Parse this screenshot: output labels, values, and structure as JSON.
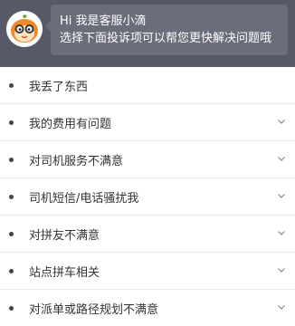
{
  "header": {
    "bubble_line1": "Hi 我是客服小滴",
    "bubble_line2": "选择下面投诉项可以帮您更快解决问题哦"
  },
  "colors": {
    "header_bg": "#575968",
    "bubble_bg": "#6b6d7a",
    "avatar_orange": "#f08a24"
  },
  "list": {
    "items": [
      {
        "label": "我丢了东西",
        "has_chevron": false
      },
      {
        "label": "我的费用有问题",
        "has_chevron": true
      },
      {
        "label": "对司机服务不满意",
        "has_chevron": true
      },
      {
        "label": "司机短信/电话骚扰我",
        "has_chevron": true
      },
      {
        "label": "对拼友不满意",
        "has_chevron": true
      },
      {
        "label": "站点拼车相关",
        "has_chevron": true
      },
      {
        "label": "对派单或路径规划不满意",
        "has_chevron": true
      }
    ]
  }
}
